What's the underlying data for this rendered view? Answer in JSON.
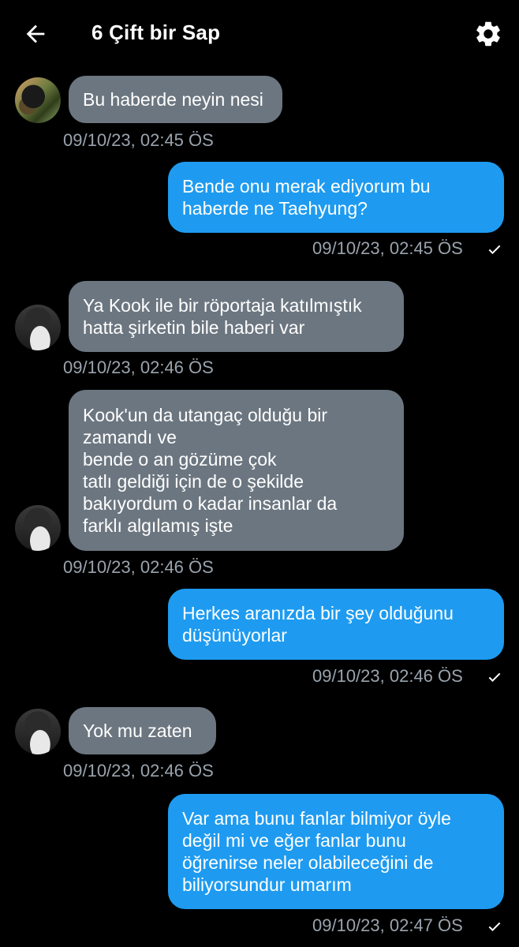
{
  "header": {
    "title": "6 Çift bir Sap",
    "back_icon": "arrow-left-icon",
    "settings_icon": "gear-icon"
  },
  "colors": {
    "incoming_bubble": "#6c7680",
    "outgoing_bubble": "#1e9bf0",
    "timestamp": "#9aa3ad",
    "background": "#000000"
  },
  "messages": [
    {
      "direction": "in",
      "text": "Bu haberde neyin nesi",
      "time": "09/10/23, 02:45 ÖS"
    },
    {
      "direction": "out",
      "text": "Bende onu merak ediyorum bu\nhaberde ne Taehyung?",
      "time": "09/10/23, 02:45 ÖS",
      "read": true
    },
    {
      "direction": "in",
      "text": "Ya Kook ile bir röportaja katılmıştık\nhatta şirketin bile haberi var",
      "time": "09/10/23, 02:46 ÖS"
    },
    {
      "direction": "in",
      "text": "Kook'un da utangaç olduğu bir\nzamandı ve\nbende o an gözüme çok\ntatlı geldiği için de o şekilde\nbakıyordum o kadar insanlar da\nfarklı algılamış işte",
      "time": "09/10/23, 02:46 ÖS"
    },
    {
      "direction": "out",
      "text": "Herkes aranızda bir şey olduğunu\ndüşünüyorlar",
      "time": "09/10/23, 02:46 ÖS",
      "read": true
    },
    {
      "direction": "in",
      "text": "Yok mu zaten",
      "time": "09/10/23, 02:46 ÖS"
    },
    {
      "direction": "out",
      "text": "Var ama bunu fanlar bilmiyor öyle\ndeğil mi ve eğer fanlar bunu\nöğrenirse neler olabileceğini de\nbiliyorsundur umarım",
      "time": "09/10/23, 02:47 ÖS",
      "read": true
    }
  ]
}
